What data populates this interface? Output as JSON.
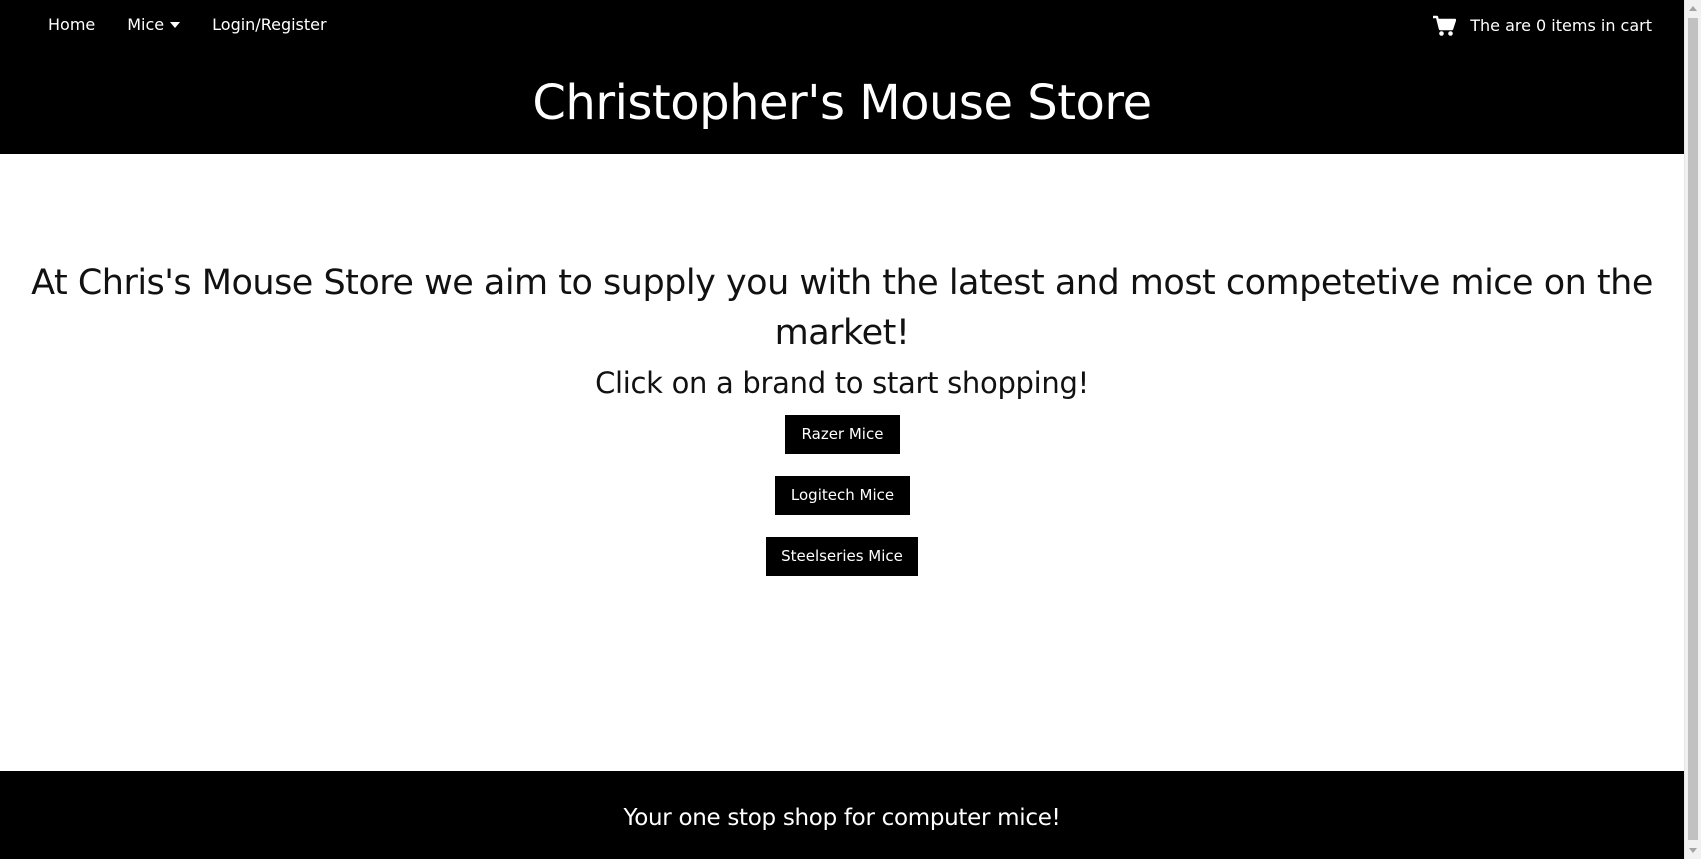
{
  "nav": {
    "items": [
      {
        "label": "Home"
      },
      {
        "label": "Mice"
      },
      {
        "label": "Login/Register"
      }
    ]
  },
  "cart": {
    "icon": "shopping-cart-icon",
    "text": "The are 0 items in cart",
    "count": 0
  },
  "header": {
    "title": "Christopher's Mouse Store"
  },
  "main": {
    "tagline": "At Chris's Mouse Store we aim to supply you with the latest and most competetive mice on the market!",
    "prompt": "Click on a brand to start shopping!",
    "brands": [
      {
        "label": "Razer Mice"
      },
      {
        "label": "Logitech Mice"
      },
      {
        "label": "Steelseries Mice"
      }
    ]
  },
  "footer": {
    "text": "Your one stop shop for computer mice!"
  },
  "colors": {
    "header_bg": "#000000",
    "footer_bg": "#000000",
    "button_bg": "#000000",
    "text_light": "#ffffff",
    "text_dark": "#111111"
  }
}
